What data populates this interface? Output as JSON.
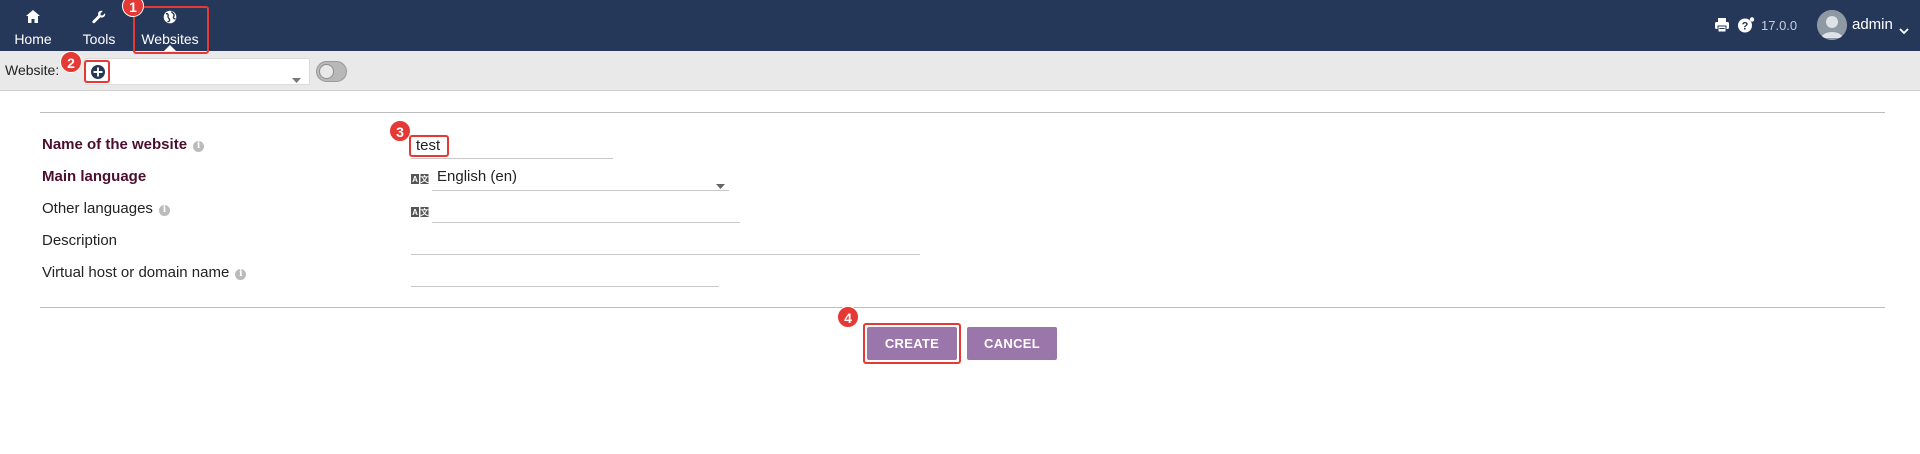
{
  "nav": {
    "items": [
      {
        "label": "Home",
        "icon": "home-icon"
      },
      {
        "label": "Tools",
        "icon": "wrench-icon"
      },
      {
        "label": "Websites",
        "icon": "globe-icon"
      }
    ]
  },
  "topbar": {
    "version": "17.0.0",
    "user": "admin",
    "icons": [
      "printer-icon",
      "help-icon"
    ]
  },
  "website_bar": {
    "label": "Website:",
    "selected_value": "",
    "toggle_on": false
  },
  "form": {
    "fields": [
      {
        "label": "Name of the website",
        "value": "test",
        "required": true,
        "has_info": true
      },
      {
        "label": "Main language",
        "value": "English (en)",
        "required": true,
        "has_info": false
      },
      {
        "label": "Other languages",
        "value": "",
        "required": false,
        "has_info": true
      },
      {
        "label": "Description",
        "value": "",
        "required": false,
        "has_info": false
      },
      {
        "label": "Virtual host or domain name",
        "value": "",
        "required": false,
        "has_info": true
      }
    ],
    "buttons": {
      "create": "CREATE",
      "cancel": "CANCEL"
    }
  },
  "annotations": [
    "1",
    "2",
    "3",
    "4"
  ],
  "colors": {
    "topbar": "#263859",
    "accent_button": "#9b76aa",
    "required_label": "#4b0f2e",
    "annotation": "#e53935"
  }
}
